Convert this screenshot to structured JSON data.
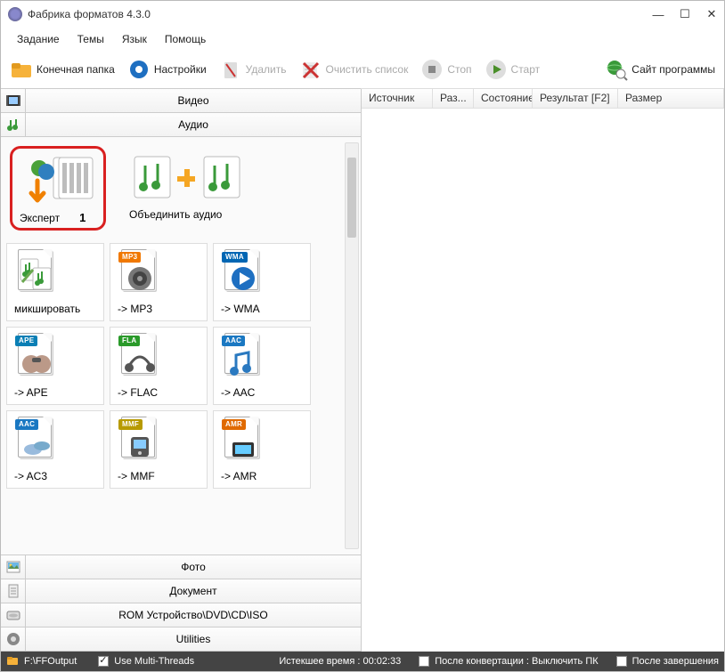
{
  "window": {
    "title": "Фабрика форматов 4.3.0"
  },
  "menu": {
    "task": "Задание",
    "themes": "Темы",
    "language": "Язык",
    "help": "Помощь"
  },
  "toolbar": {
    "output_folder": "Конечная папка",
    "settings": "Настройки",
    "delete": "Удалить",
    "clear_list": "Очистить список",
    "stop": "Стоп",
    "start": "Старт",
    "website": "Сайт программы"
  },
  "categories": {
    "video": "Видео",
    "audio": "Аудио",
    "photo": "Фото",
    "document": "Документ",
    "rom": "ROM Устройство\\DVD\\CD\\ISO",
    "utilities": "Utilities"
  },
  "audio_top": {
    "expert_label": "Эксперт",
    "expert_badge": "1",
    "merge_label": "Объединить аудио"
  },
  "formats": [
    {
      "label": "микшировать",
      "tag": "",
      "tagColor": ""
    },
    {
      "label": "-> MP3",
      "tag": "MP3",
      "tagColor": "#f07800"
    },
    {
      "label": "-> WMA",
      "tag": "WMA",
      "tagColor": "#0066b3"
    },
    {
      "label": "-> APE",
      "tag": "APE",
      "tagColor": "#0a7fb5"
    },
    {
      "label": "-> FLAC",
      "tag": "FLA",
      "tagColor": "#2a9a2a"
    },
    {
      "label": "-> AAC",
      "tag": "AAC",
      "tagColor": "#1a78c2"
    },
    {
      "label": "-> AC3",
      "tag": "AAC",
      "tagColor": "#1a78c2"
    },
    {
      "label": "-> MMF",
      "tag": "MMF",
      "tagColor": "#b79a00"
    },
    {
      "label": "-> AMR",
      "tag": "AMR",
      "tagColor": "#e06a00"
    }
  ],
  "list_headers": {
    "source": "Источник",
    "size_in": "Раз...",
    "state": "Состояние",
    "result": "Результат [F2]",
    "size_out": "Размер"
  },
  "status": {
    "folder_path": "F:\\FFOutput",
    "multithread": "Use Multi-Threads",
    "elapsed": "Истекшее время : 00:02:33",
    "after_convert": "После конвертации : Выключить ПК",
    "after_finish": "После завершения"
  }
}
